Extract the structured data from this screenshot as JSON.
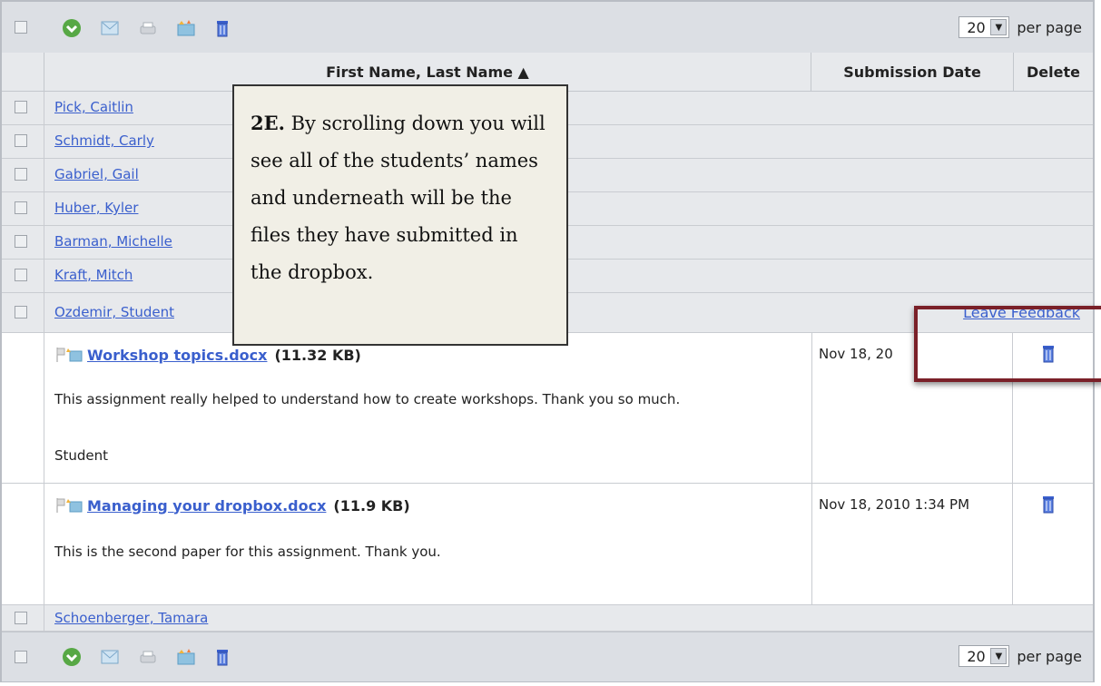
{
  "toolbar": {
    "per_page_value": "20",
    "per_page_label": "per page",
    "icons": [
      "checkbox-icon",
      "download-icon",
      "email-icon",
      "print-icon",
      "folder-move-icon",
      "trash-icon"
    ]
  },
  "table": {
    "headers": {
      "name": "First Name, Last Name ▲",
      "date": "Submission Date",
      "delete": "Delete"
    },
    "students": [
      "Pick, Caitlin",
      "Schmidt, Carly",
      "Gabriel, Gail",
      "Huber, Kyler",
      "Barman, Michelle",
      "Kraft, Mitch",
      "Ozdemir, Student"
    ],
    "feedback_link": "Leave Feedback",
    "submissions": [
      {
        "file": "Workshop topics.docx",
        "size": "(11.32 KB)",
        "date": "Nov 18, 20",
        "comment_lines": [
          "This assignment really helped to understand how to create workshops. Thank you so much.",
          "Student"
        ]
      },
      {
        "file": "Managing your dropbox.docx",
        "size": "(11.9 KB)",
        "date": "Nov 18, 2010 1:34 PM",
        "comment_lines": [
          "This is the second paper for this assignment. Thank you."
        ]
      }
    ],
    "last_student": "Schoenberger, Tamara"
  },
  "callout": {
    "step": "2E.",
    "text": "By scrolling down you will see all of the students’ names and underneath will be the files they have submitted in the dropbox."
  },
  "colors": {
    "link": "#3a5fcd",
    "highlight_border": "#7a2028",
    "toolbar_bg": "#dcdfe4"
  }
}
